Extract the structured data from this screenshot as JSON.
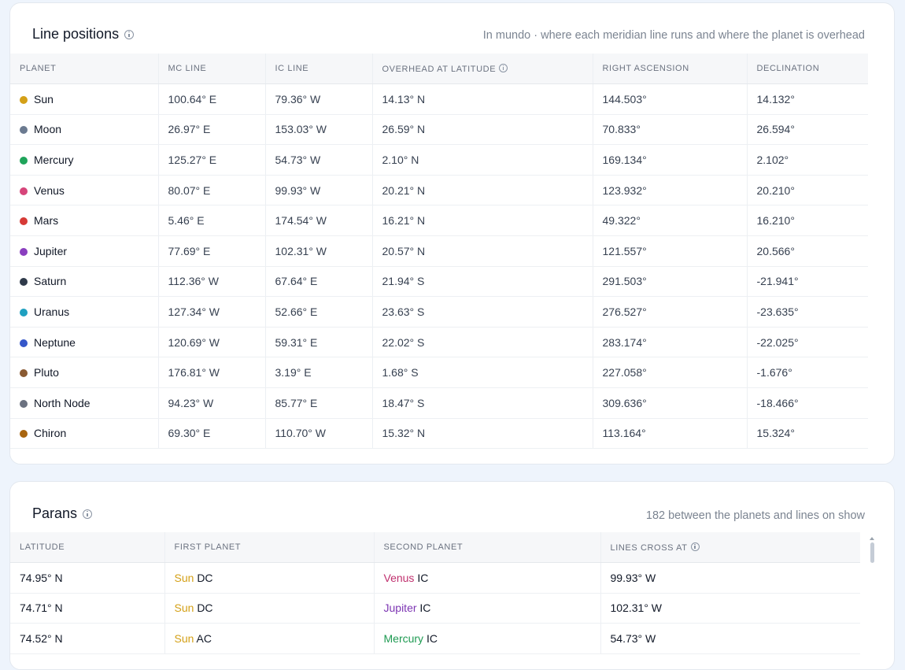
{
  "line_positions": {
    "title": "Line positions",
    "subtitle": "In mundo · where each meridian line runs and where the planet is overhead",
    "columns": [
      "PLANET",
      "MC LINE",
      "IC LINE",
      "OVERHEAD AT LATITUDE",
      "RIGHT ASCENSION",
      "DECLINATION"
    ],
    "rows": [
      {
        "planet": "Sun",
        "color": "#d4a017",
        "mc": "100.64° E",
        "ic": "79.36° W",
        "overhead": "14.13° N",
        "ra": "144.503°",
        "dec": "14.132°"
      },
      {
        "planet": "Moon",
        "color": "#6b7a90",
        "mc": "26.97° E",
        "ic": "153.03° W",
        "overhead": "26.59° N",
        "ra": "70.833°",
        "dec": "26.594°"
      },
      {
        "planet": "Mercury",
        "color": "#1fa45a",
        "mc": "125.27° E",
        "ic": "54.73° W",
        "overhead": "2.10° N",
        "ra": "169.134°",
        "dec": "2.102°"
      },
      {
        "planet": "Venus",
        "color": "#d6457a",
        "mc": "80.07° E",
        "ic": "99.93° W",
        "overhead": "20.21° N",
        "ra": "123.932°",
        "dec": "20.210°"
      },
      {
        "planet": "Mars",
        "color": "#d63a36",
        "mc": "5.46° E",
        "ic": "174.54° W",
        "overhead": "16.21° N",
        "ra": "49.322°",
        "dec": "16.210°"
      },
      {
        "planet": "Jupiter",
        "color": "#8a3fbf",
        "mc": "77.69° E",
        "ic": "102.31° W",
        "overhead": "20.57° N",
        "ra": "121.557°",
        "dec": "20.566°"
      },
      {
        "planet": "Saturn",
        "color": "#2f3a4a",
        "mc": "112.36° W",
        "ic": "67.64° E",
        "overhead": "21.94° S",
        "ra": "291.503°",
        "dec": "-21.941°"
      },
      {
        "planet": "Uranus",
        "color": "#1fa0c0",
        "mc": "127.34° W",
        "ic": "52.66° E",
        "overhead": "23.63° S",
        "ra": "276.527°",
        "dec": "-23.635°"
      },
      {
        "planet": "Neptune",
        "color": "#3557c9",
        "mc": "120.69° W",
        "ic": "59.31° E",
        "overhead": "22.02° S",
        "ra": "283.174°",
        "dec": "-22.025°"
      },
      {
        "planet": "Pluto",
        "color": "#8a5a32",
        "mc": "176.81° W",
        "ic": "3.19° E",
        "overhead": "1.68° S",
        "ra": "227.058°",
        "dec": "-1.676°"
      },
      {
        "planet": "North Node",
        "color": "#6b7280",
        "mc": "94.23° W",
        "ic": "85.77° E",
        "overhead": "18.47° S",
        "ra": "309.636°",
        "dec": "-18.466°"
      },
      {
        "planet": "Chiron",
        "color": "#a8650f",
        "mc": "69.30° E",
        "ic": "110.70° W",
        "overhead": "15.32° N",
        "ra": "113.164°",
        "dec": "15.324°"
      }
    ]
  },
  "parans": {
    "title": "Parans",
    "subtitle": "182 between the planets and lines on show",
    "columns": [
      "LATITUDE",
      "FIRST PLANET",
      "SECOND PLANET",
      "LINES CROSS AT"
    ],
    "rows": [
      {
        "latitude": "74.95° N",
        "first_planet": "Sun",
        "first_color": "#d4a017",
        "first_line": "DC",
        "second_planet": "Venus",
        "second_color": "#c0306e",
        "second_line": "IC",
        "cross": "99.93° W"
      },
      {
        "latitude": "74.71° N",
        "first_planet": "Sun",
        "first_color": "#d4a017",
        "first_line": "DC",
        "second_planet": "Jupiter",
        "second_color": "#7d35b3",
        "second_line": "IC",
        "cross": "102.31° W"
      },
      {
        "latitude": "74.52° N",
        "first_planet": "Sun",
        "first_color": "#d4a017",
        "first_line": "AC",
        "second_planet": "Mercury",
        "second_color": "#1e9a52",
        "second_line": "IC",
        "cross": "54.73° W"
      }
    ]
  }
}
